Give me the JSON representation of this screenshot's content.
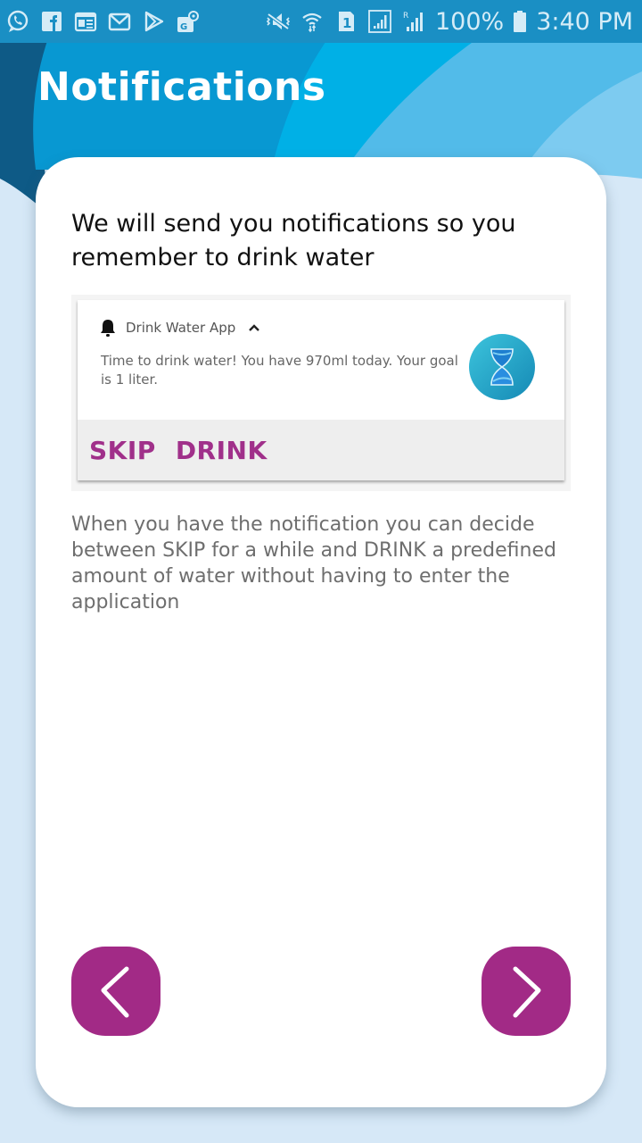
{
  "status_bar": {
    "left_icons": [
      "whatsapp-icon",
      "facebook-icon",
      "news-icon",
      "gmail-icon",
      "play-store-icon",
      "maps-icon"
    ],
    "right_icons": [
      "vibrate-mute-icon",
      "wifi-icon",
      "sim-1-icon",
      "signal-icon",
      "roaming-signal-icon"
    ],
    "battery": "100%",
    "time": "3:40 PM"
  },
  "header": {
    "title": "Notifications"
  },
  "card": {
    "heading": "We will send you notifications so you remember to drink water",
    "notification": {
      "app_name": "Drink Water App",
      "message": "Time to drink water! You have 970ml today. Your goal is 1 liter.",
      "icon": "hourglass-icon",
      "actions": [
        "SKIP",
        "DRINK"
      ]
    },
    "description": "When you have the notification you can decide between SKIP for a while and DRINK a predefined amount of water without having to enter the application"
  },
  "navigation": {
    "prev_icon": "chevron-left-icon",
    "next_icon": "chevron-right-icon"
  },
  "colors": {
    "accent": "#a22a86",
    "status_bar": "#1a8fc4",
    "header_blue": "#0a9bd4",
    "background": "#d6e8f7"
  }
}
